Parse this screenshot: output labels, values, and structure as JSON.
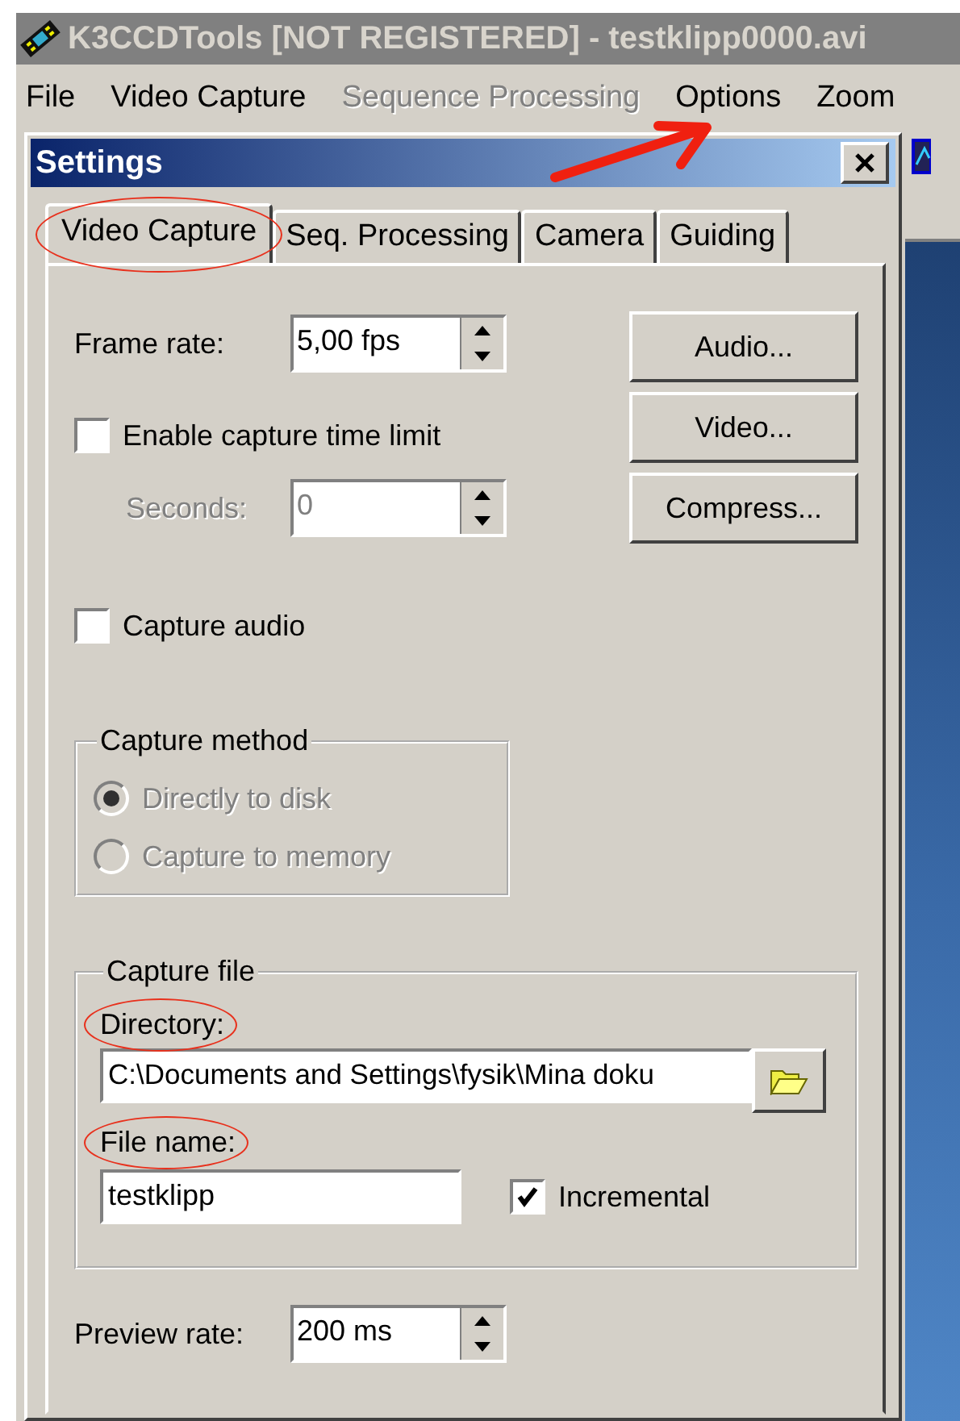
{
  "app": {
    "title": "K3CCDTools [NOT REGISTERED] - testklipp0000.avi"
  },
  "menu": [
    {
      "label": "File",
      "disabled": false
    },
    {
      "label": "Video Capture",
      "disabled": false
    },
    {
      "label": "Sequence Processing",
      "disabled": true
    },
    {
      "label": "Options",
      "disabled": false
    },
    {
      "label": "Zoom",
      "disabled": false
    }
  ],
  "dialog": {
    "title": "Settings"
  },
  "tabs": [
    {
      "label": "Video Capture",
      "selected": true,
      "circled": true
    },
    {
      "label": "Seq. Processing",
      "selected": false,
      "circled": false
    },
    {
      "label": "Camera",
      "selected": false,
      "circled": false
    },
    {
      "label": "Guiding",
      "selected": false,
      "circled": false
    }
  ],
  "frame_rate": {
    "label": "Frame rate:",
    "value": "5,00 fps"
  },
  "time_limit": {
    "label": "Enable capture time limit",
    "checked": false
  },
  "seconds": {
    "label": "Seconds:",
    "value": "0",
    "disabled": true
  },
  "buttons": [
    "Audio...",
    "Video...",
    "Compress..."
  ],
  "capture_audio": {
    "label": "Capture audio",
    "checked": false
  },
  "capture_method": {
    "title": "Capture method",
    "disabled": true,
    "options": [
      {
        "label": "Directly to disk",
        "selected": true
      },
      {
        "label": "Capture to memory",
        "selected": false
      }
    ]
  },
  "capture_file": {
    "title": "Capture file",
    "directory_label": "Directory:",
    "directory_circled": true,
    "directory": "C:\\Documents and Settings\\fysik\\Mina doku",
    "file_name_label": "File name:",
    "file_name_circled": true,
    "file_name": "testklipp",
    "incremental": {
      "label": "Incremental",
      "checked": true
    }
  },
  "preview_rate": {
    "label": "Preview rate:",
    "value": "200 ms"
  }
}
